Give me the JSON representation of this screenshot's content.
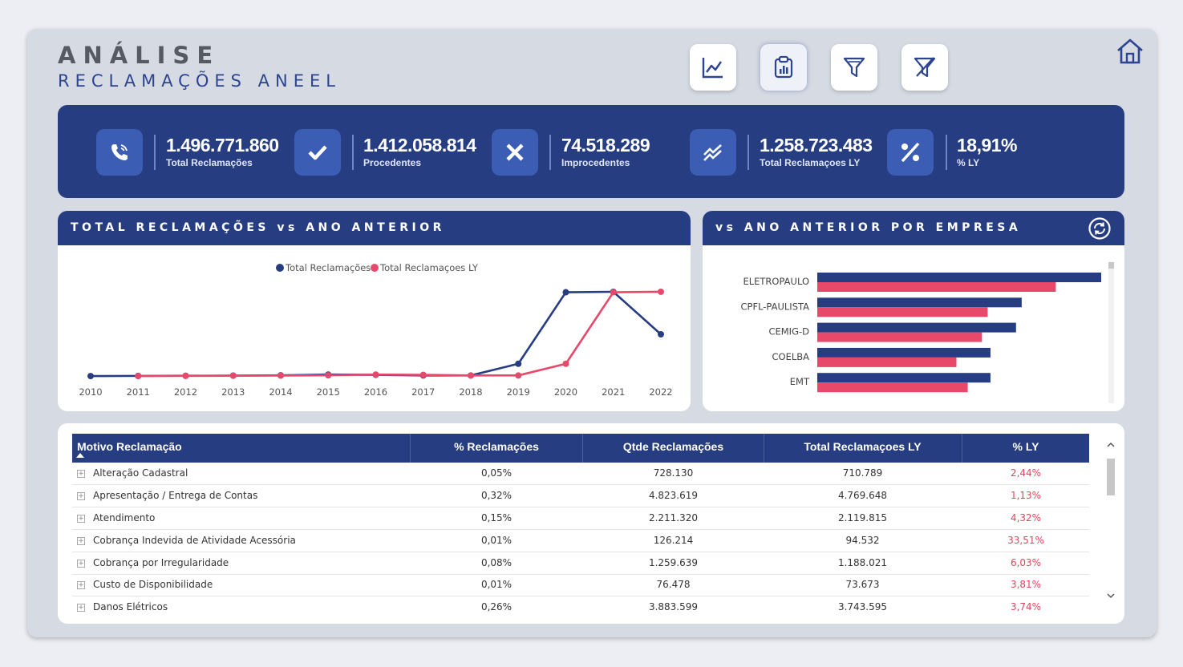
{
  "header": {
    "title": "ANÁLISE",
    "subtitle": "RECLAMAÇÕES ANEEL"
  },
  "nav": {
    "buttons": [
      {
        "name": "line-chart-icon",
        "active": false
      },
      {
        "name": "clipboard-chart-icon",
        "active": true
      },
      {
        "name": "filter-icon",
        "active": false
      },
      {
        "name": "clear-filter-icon",
        "active": false
      }
    ],
    "home_icon": "home-icon"
  },
  "kpis": [
    {
      "icon": "phone-icon",
      "value": "1.496.771.860",
      "label": "Total Reclamações"
    },
    {
      "icon": "check-icon",
      "value": "1.412.058.814",
      "label": "Procedentes"
    },
    {
      "icon": "x-icon",
      "value": "74.518.289",
      "label": "Improcedentes"
    },
    {
      "icon": "trend-icon",
      "value": "1.258.723.483",
      "label": "Total Reclamaçoes LY"
    },
    {
      "icon": "percent-icon",
      "value": "18,91%",
      "label": "% LY"
    }
  ],
  "line_card": {
    "title": "TOTAL RECLAMAÇÕES vs ANO ANTERIOR"
  },
  "bar_card": {
    "title": "vs ANO ANTERIOR POR EMPRESA",
    "icon": "refresh-icon"
  },
  "colors": {
    "navy": "#263d82",
    "pink": "#e8496a",
    "accent": "#3b5db3"
  },
  "chart_data": [
    {
      "type": "line",
      "x": [
        "2010",
        "2011",
        "2012",
        "2013",
        "2014",
        "2015",
        "2016",
        "2017",
        "2018",
        "2019",
        "2020",
        "2021",
        "2022"
      ],
      "series": [
        {
          "name": "Total Reclamações",
          "color": "#263d82",
          "values": [
            0.5,
            0.6,
            0.7,
            0.8,
            1.0,
            1.5,
            1.3,
            0.9,
            0.9,
            8.7,
            56.5,
            56.8,
            28.4
          ]
        },
        {
          "name": "Total Reclamaçoes LY",
          "color": "#e8496a",
          "values": [
            null,
            0.5,
            0.6,
            0.7,
            0.8,
            1.0,
            1.5,
            1.3,
            0.9,
            0.9,
            8.7,
            56.5,
            56.8
          ]
        }
      ],
      "ylim": [
        0,
        60
      ],
      "legend": "top-center",
      "grid": false,
      "title": "",
      "xlabel": "",
      "ylabel": ""
    },
    {
      "type": "bar",
      "orientation": "horizontal",
      "categories": [
        "ELETROPAULO",
        "CPFL-PAULISTA",
        "CEMIG-D",
        "COELBA",
        "EMT"
      ],
      "series": [
        {
          "color": "#263d82",
          "values": [
            100,
            72,
            70,
            61,
            61
          ]
        },
        {
          "color": "#e8496a",
          "values": [
            84,
            60,
            58,
            49,
            53
          ]
        }
      ],
      "xlim": [
        0,
        100
      ],
      "grid": false
    }
  ],
  "table": {
    "columns": [
      "Motivo Reclamação",
      "% Reclamações",
      "Qtde Reclamações",
      "Total Reclamaçoes LY",
      "% LY"
    ],
    "rows": [
      [
        "Alteração Cadastral",
        "0,05%",
        "728.130",
        "710.789",
        "2,44%"
      ],
      [
        "Apresentação / Entrega de Contas",
        "0,32%",
        "4.823.619",
        "4.769.648",
        "1,13%"
      ],
      [
        "Atendimento",
        "0,15%",
        "2.211.320",
        "2.119.815",
        "4,32%"
      ],
      [
        "Cobrança Indevida de Atividade Acessória",
        "0,01%",
        "126.214",
        "94.532",
        "33,51%"
      ],
      [
        "Cobrança por Irregularidade",
        "0,08%",
        "1.259.639",
        "1.188.021",
        "6,03%"
      ],
      [
        "Custo de Disponibilidade",
        "0,01%",
        "76.478",
        "73.673",
        "3,81%"
      ],
      [
        "Danos Elétricos",
        "0,26%",
        "3.883.599",
        "3.743.595",
        "3,74%"
      ]
    ]
  }
}
